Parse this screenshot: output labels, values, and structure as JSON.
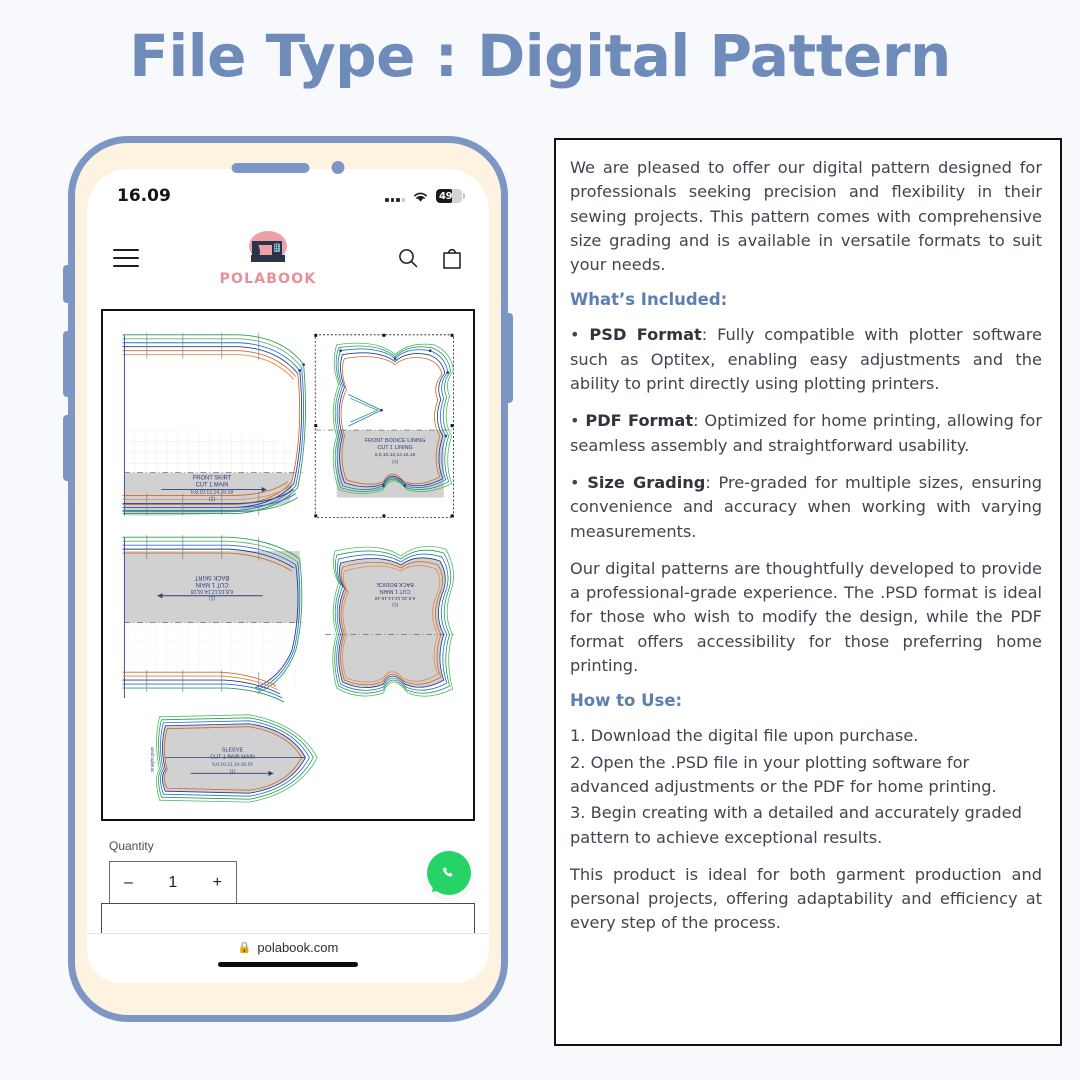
{
  "page": {
    "title": "File Type : Digital Pattern",
    "background_color": "#f7f9fd",
    "title_color": "#6e8bb9"
  },
  "phone": {
    "frame_color": "#7d96c4",
    "bezel_color": "#fdf3e0",
    "status_bar": {
      "time": "16.09",
      "signal": "signal-dots-icon",
      "wifi": "wifi-icon",
      "battery_level": "49",
      "battery_icon": "battery-icon"
    },
    "site_header": {
      "menu_icon": "hamburger-menu-icon",
      "brand_name": "POLABOOK",
      "brand_logo": "sewing-machine-logo",
      "brand_color": "#e8909a",
      "search_icon": "search-icon",
      "cart_icon": "shopping-bag-icon"
    },
    "product_image": {
      "alt": "digital sewing pattern sheet with graded size lines",
      "pieces": [
        {
          "name": "FRONT SKIRT",
          "cut": "CUT 1 MAIN",
          "sizes": "6,8,10,12,14,16,18",
          "qty": "(1)"
        },
        {
          "name": "FRONT BODICE LINING",
          "cut": "CUT 1 LINING",
          "sizes": "6,8,10,12,14,16,18",
          "qty": "(1)"
        },
        {
          "name": "BACK SKIRT",
          "cut": "CUT 1 MAIN",
          "sizes": "6,8,10,12,14,16,18",
          "qty": "(1)"
        },
        {
          "name": "BACK BODICE",
          "cut": "CUT 1 MAIN",
          "sizes": "6,8,10,12,14,16,18",
          "qty": "(1)"
        },
        {
          "name": "SLEEVE",
          "cut": "CUT 1 PAIR MAIN",
          "sizes": "6,8,10,12,14,16,18",
          "qty": "(1)"
        }
      ],
      "grain_label": "straight grain"
    },
    "quantity": {
      "label": "Quantity",
      "decrement": "–",
      "value": "1",
      "increment": "+"
    },
    "whatsapp_button": "whatsapp-icon",
    "browser": {
      "lock_icon": "🔒",
      "url": "polabook.com"
    }
  },
  "description": {
    "heading_color": "#5b7fae",
    "intro": "We are pleased to offer our digital pattern designed for professionals seeking precision and flexibility in their sewing projects. This pattern comes with comprehensive size grading and is available in versatile formats to suit your needs.",
    "included_heading": "What’s Included:",
    "bullets": [
      {
        "label": "PSD Format",
        "prefix": " • ",
        "text": ": Fully compatible with plotter software such as Optitex, enabling easy adjustments and the ability to print directly using plotting printers."
      },
      {
        "label": "PDF Format",
        "prefix": " • ",
        "text": ": Optimized for home printing, allowing for seamless assembly and straightforward usability."
      },
      {
        "label": "Size Grading",
        "prefix": " • ",
        "text": ": Pre-graded for multiple sizes, ensuring convenience and accuracy when working with varying measurements."
      }
    ],
    "body": "Our digital patterns are thoughtfully developed to provide a professional-grade experience. The .PSD format is ideal for those who wish to modify the design, while the PDF format offers accessibility for those preferring home printing.",
    "how_to_heading": "How to Use:",
    "steps": [
      " 1. Download the digital file upon purchase.",
      " 2. Open the .PSD file in your plotting software for advanced adjustments or the PDF for home printing.",
      " 3. Begin creating with a detailed and accurately graded pattern to achieve exceptional results."
    ],
    "closing": "This product is ideal for both garment production and personal projects, offering adaptability and efficiency at every step of the process."
  }
}
